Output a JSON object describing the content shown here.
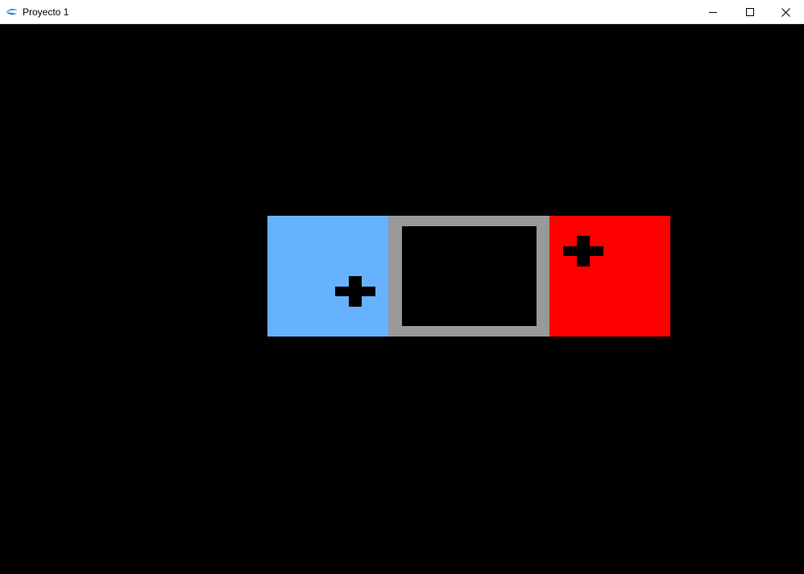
{
  "window": {
    "title": "Proyecto 1",
    "icon": "app-logo-icon",
    "controls": {
      "minimize_icon": "minimize-icon",
      "maximize_icon": "maximize-icon",
      "close_icon": "close-icon"
    }
  },
  "scene": {
    "background_color": "#000000",
    "tiles": [
      {
        "name": "blue-tile",
        "color": "#66b2ff",
        "has_cross": true
      },
      {
        "name": "gray-frame",
        "color": "#999999",
        "inner_color": "#000000"
      },
      {
        "name": "red-tile",
        "color": "#ff0000",
        "has_cross": true
      }
    ],
    "cross_color": "#000000",
    "cross_icon": "plus-icon"
  }
}
